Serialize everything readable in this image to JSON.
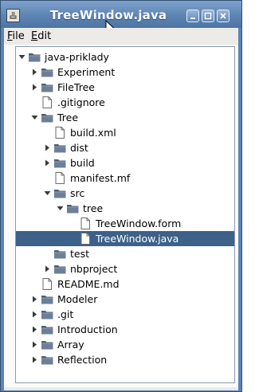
{
  "window": {
    "title": "TreeWindow.java"
  },
  "menu": {
    "file": "File",
    "edit": "Edit",
    "file_mnemonic": "F",
    "edit_mnemonic": "E"
  },
  "tree": [
    {
      "label": "java-priklady",
      "type": "folder",
      "level": 0,
      "expanded": true,
      "toggle": "expanded",
      "selected": false
    },
    {
      "label": "Experiment",
      "type": "folder",
      "level": 1,
      "toggle": "collapsed",
      "selected": false
    },
    {
      "label": "FileTree",
      "type": "folder",
      "level": 1,
      "toggle": "collapsed",
      "selected": false
    },
    {
      "label": ".gitignore",
      "type": "file",
      "level": 1,
      "toggle": "none",
      "selected": false
    },
    {
      "label": "Tree",
      "type": "folder",
      "level": 1,
      "toggle": "expanded",
      "selected": false
    },
    {
      "label": "build.xml",
      "type": "file",
      "level": 2,
      "toggle": "none",
      "selected": false
    },
    {
      "label": "dist",
      "type": "folder",
      "level": 2,
      "toggle": "collapsed",
      "selected": false
    },
    {
      "label": "build",
      "type": "folder",
      "level": 2,
      "toggle": "collapsed",
      "selected": false
    },
    {
      "label": "manifest.mf",
      "type": "file",
      "level": 2,
      "toggle": "none",
      "selected": false
    },
    {
      "label": "src",
      "type": "folder",
      "level": 2,
      "toggle": "expanded",
      "selected": false
    },
    {
      "label": "tree",
      "type": "folder",
      "level": 3,
      "toggle": "expanded",
      "selected": false
    },
    {
      "label": "TreeWindow.form",
      "type": "file",
      "level": 4,
      "toggle": "none",
      "selected": false
    },
    {
      "label": "TreeWindow.java",
      "type": "file",
      "level": 4,
      "toggle": "none",
      "selected": true
    },
    {
      "label": "test",
      "type": "folder",
      "level": 2,
      "toggle": "none",
      "selected": false
    },
    {
      "label": "nbproject",
      "type": "folder",
      "level": 2,
      "toggle": "collapsed",
      "selected": false
    },
    {
      "label": "README.md",
      "type": "file",
      "level": 1,
      "toggle": "none",
      "selected": false
    },
    {
      "label": "Modeler",
      "type": "folder",
      "level": 1,
      "toggle": "collapsed",
      "selected": false
    },
    {
      "label": ".git",
      "type": "folder",
      "level": 1,
      "toggle": "collapsed",
      "selected": false
    },
    {
      "label": "Introduction",
      "type": "folder",
      "level": 1,
      "toggle": "collapsed",
      "selected": false
    },
    {
      "label": "Array",
      "type": "folder",
      "level": 1,
      "toggle": "collapsed",
      "selected": false
    },
    {
      "label": "Reflection",
      "type": "folder",
      "level": 1,
      "toggle": "collapsed",
      "selected": false
    }
  ],
  "colors": {
    "selection": "#3d6189",
    "titlebar": "#5d84b2",
    "folder": "#5f6f86"
  },
  "icons": {
    "folder": "folder-icon",
    "file": "file-icon",
    "expanded": "chevron-down-icon",
    "collapsed": "chevron-right-icon"
  }
}
